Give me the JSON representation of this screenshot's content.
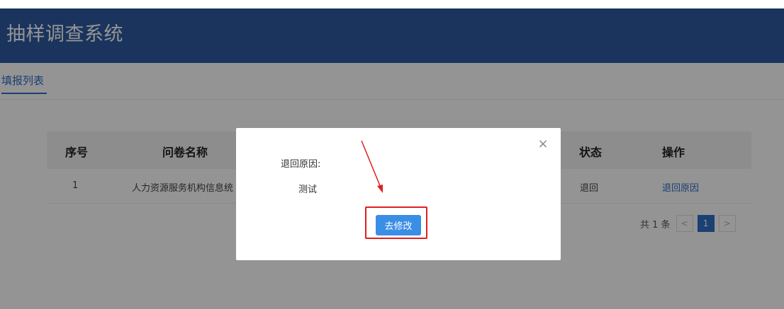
{
  "header": {
    "title": "抽样调查系统"
  },
  "tabs": [
    {
      "label": "填报列表"
    }
  ],
  "table": {
    "headers": {
      "index": "序号",
      "name": "问卷名称",
      "status": "状态",
      "action": "操作"
    },
    "rows": [
      {
        "index": "1",
        "name": "人力资源服务机构信息统",
        "status": "退回",
        "action": "退回原因"
      }
    ]
  },
  "pagination": {
    "total": "共 1 条",
    "prev": "<",
    "current": "1",
    "next": ">"
  },
  "modal": {
    "close": "×",
    "reason_label": "退回原因:",
    "reason_value": "测试",
    "edit_button": "去修改"
  },
  "colors": {
    "header_bg": "#2d5aa0",
    "accent": "#2f6ec6",
    "button": "#3a8ee6",
    "annotation": "#e02020"
  }
}
